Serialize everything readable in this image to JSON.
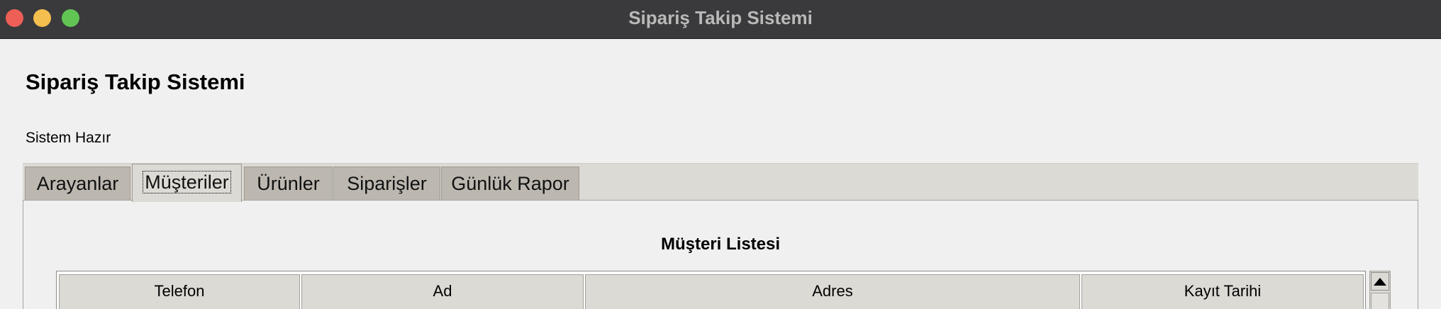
{
  "window": {
    "title": "Sipariş Takip Sistemi"
  },
  "app": {
    "heading": "Sipariş Takip Sistemi",
    "status": "Sistem Hazır"
  },
  "tabs": [
    {
      "label": "Arayanlar",
      "active": false
    },
    {
      "label": "Müşteriler",
      "active": true
    },
    {
      "label": "Ürünler",
      "active": false
    },
    {
      "label": "Siparişler",
      "active": false
    },
    {
      "label": "Günlük Rapor",
      "active": false
    }
  ],
  "customers_panel": {
    "heading": "Müşteri Listesi",
    "columns": [
      "Telefon",
      "Ad",
      "Adres",
      "Kayıt Tarihi"
    ]
  },
  "colors": {
    "titlebar": "#3a3a3c",
    "window_bg": "#f0f0f0",
    "tab_inactive": "#bcb8b0",
    "tab_active": "#dcdad5"
  }
}
